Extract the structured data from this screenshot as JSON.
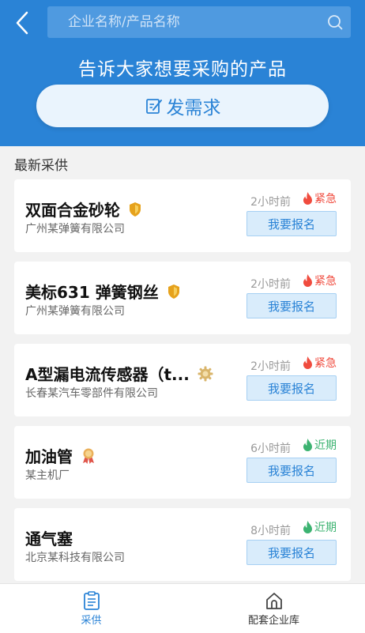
{
  "search": {
    "placeholder": "企业名称/产品名称"
  },
  "banner": {
    "title": "告诉大家想要采购的产品",
    "post_button": "发需求"
  },
  "section_title": "最新采供",
  "action_label": "我要报名",
  "colors": {
    "primary": "#2a83d6",
    "urgent": "#f04b3e",
    "recent": "#3cb371"
  },
  "cards": [
    {
      "title": "双面合金砂轮",
      "company": "广州某弹簧有限公司",
      "time": "2小时前",
      "tag": "紧急",
      "tag_type": "urgent",
      "badge": "shield-badge-icon"
    },
    {
      "title": "美标631 弹簧钢丝",
      "company": "广州某弹簧有限公司",
      "time": "2小时前",
      "tag": "紧急",
      "tag_type": "urgent",
      "badge": "shield-badge-icon"
    },
    {
      "title": "A型漏电流传感器（t...",
      "company": "长春某汽车零部件有限公司",
      "time": "2小时前",
      "tag": "紧急",
      "tag_type": "urgent",
      "badge": "gear-badge-icon"
    },
    {
      "title": "加油管",
      "company": "某主机厂",
      "time": "6小时前",
      "tag": "近期",
      "tag_type": "recent",
      "badge": "ribbon-badge-icon"
    },
    {
      "title": "通气塞",
      "company": "北京某科技有限公司",
      "time": "8小时前",
      "tag": "近期",
      "tag_type": "recent",
      "badge": ""
    }
  ],
  "tabs": [
    {
      "label": "采供",
      "icon": "clipboard-icon",
      "active": true
    },
    {
      "label": "配套企业库",
      "icon": "home-icon",
      "active": false
    }
  ]
}
